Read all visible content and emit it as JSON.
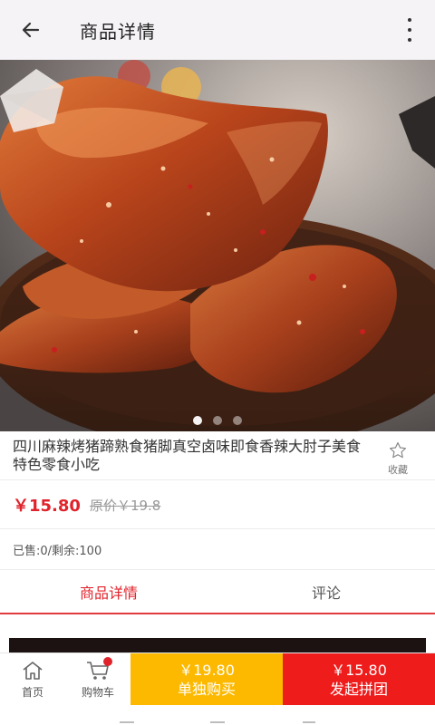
{
  "appbar": {
    "title": "商品详情",
    "back_icon": "arrow-left-icon",
    "more_icon": "more-vertical-icon"
  },
  "product": {
    "name": "四川麻辣烤猪蹄熟食猪脚真空卤味即食香辣大肘子美食特色零食小吃",
    "favorite_label": "收藏",
    "price": "￥15.80",
    "original_price": "原价￥19.8",
    "stock_text": "已售:0/剩余:100"
  },
  "carousel": {
    "count": 3,
    "active_index": 0
  },
  "tabs": [
    {
      "label": "商品详情",
      "active": true
    },
    {
      "label": "评论",
      "active": false
    }
  ],
  "bottom_nav": {
    "home_label": "首页",
    "cart_label": "购物车",
    "cart_has_badge": true,
    "single_price": "￥19.80",
    "single_label": "单独购买",
    "group_price": "￥15.80",
    "group_label": "发起拼团"
  },
  "colors": {
    "accent_red": "#e0232b",
    "buy_yellow": "#fcb900",
    "group_red": "#ef1c1c",
    "appbar_bg": "#f5f3f6"
  }
}
